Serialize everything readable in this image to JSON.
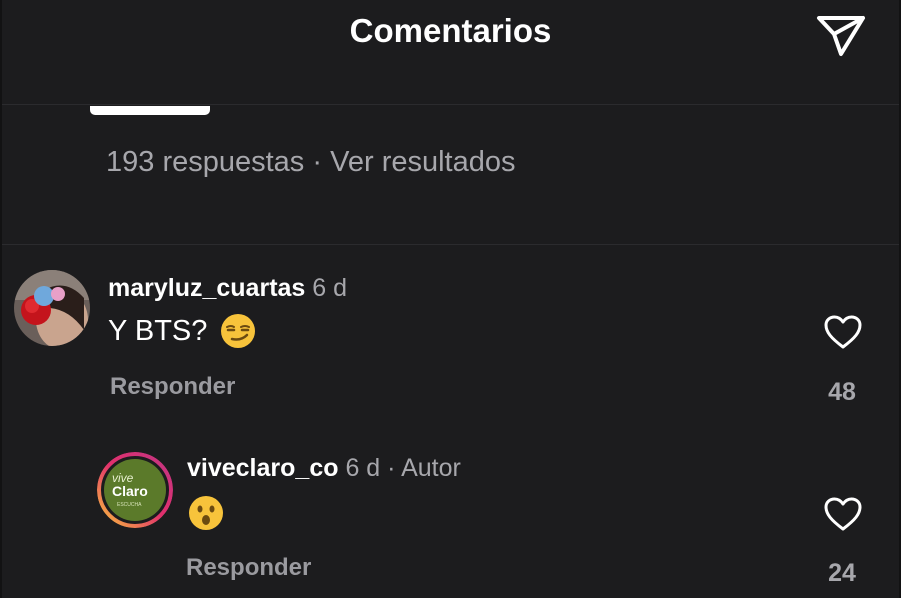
{
  "header": {
    "title": "Comentarios",
    "share_icon": "send-icon"
  },
  "poll": {
    "responses": "193 respuestas",
    "separator": "·",
    "results_link": "Ver resultados"
  },
  "comments": [
    {
      "username": "maryluz_cuartas",
      "age": "6 d",
      "text": "Y BTS?",
      "emoji": "smirking-face-emoji",
      "reply_label": "Responder",
      "likes": "48"
    },
    {
      "username": "viveclaro_co",
      "age": "6 d",
      "separator": "·",
      "author_badge": "Autor",
      "emoji": "hushed-face-emoji",
      "reply_label": "Responder",
      "likes": "24",
      "avatar_logo": {
        "line1": "vive",
        "line2": "Claro",
        "line3": "ESCUCHA",
        "ring_colors": [
          "#f9c23c",
          "#e1306c",
          "#c13584"
        ],
        "bg": "#5b7a2a"
      }
    }
  ]
}
